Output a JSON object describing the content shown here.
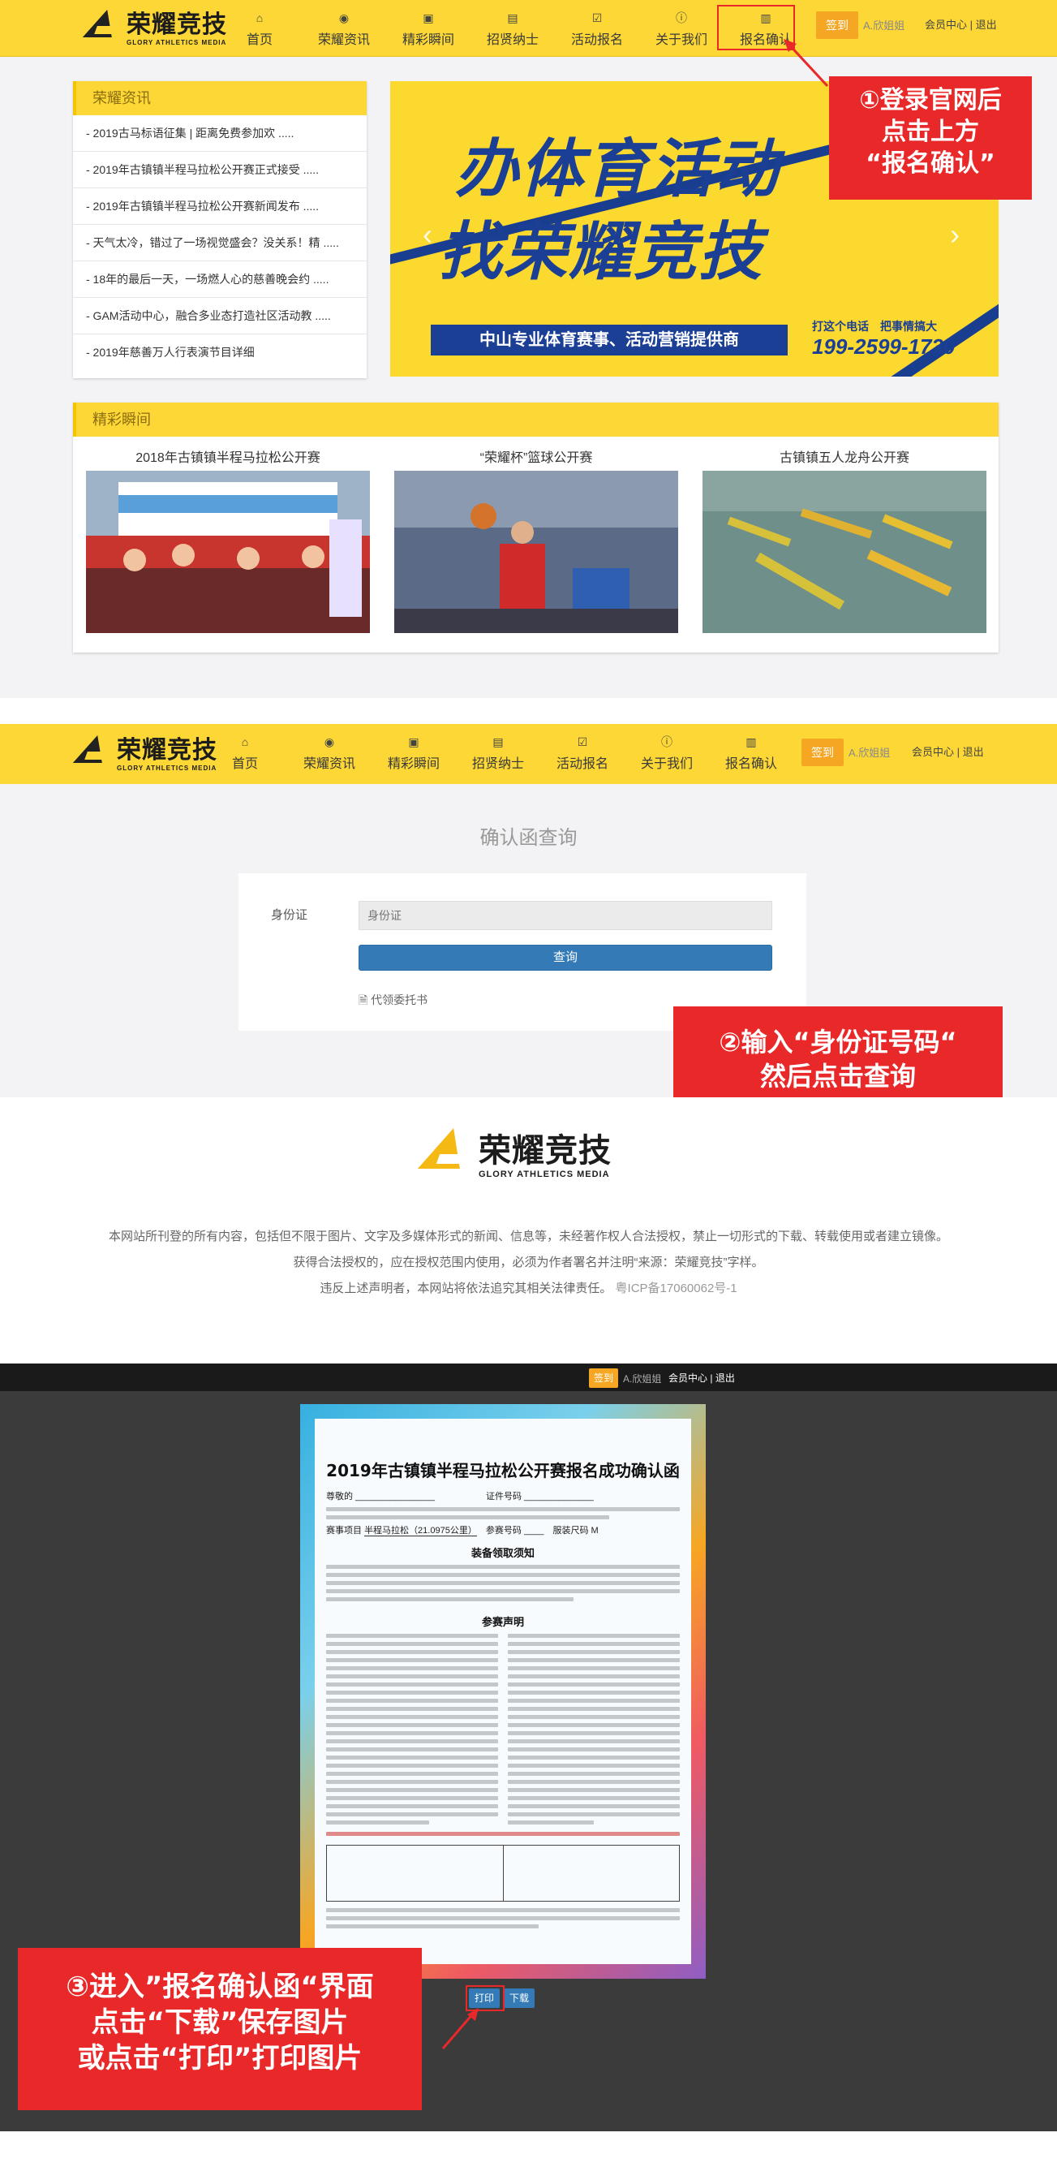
{
  "brand": {
    "name_cn": "荣耀竞技",
    "name_en": "GLORY ATHLETICS MEDIA"
  },
  "nav": [
    {
      "icon": "home-icon",
      "glyph": "⌂",
      "label": "首页"
    },
    {
      "icon": "eye-icon",
      "glyph": "◉",
      "label": "荣耀资讯"
    },
    {
      "icon": "picture-icon",
      "glyph": "▣",
      "label": "精彩瞬间"
    },
    {
      "icon": "file-icon",
      "glyph": "▤",
      "label": "招贤纳士"
    },
    {
      "icon": "checklist-icon",
      "glyph": "☑",
      "label": "活动报名"
    },
    {
      "icon": "info-icon",
      "glyph": "ⓘ",
      "label": "关于我们"
    },
    {
      "icon": "document-icon",
      "glyph": "▥",
      "label": "报名确认"
    }
  ],
  "user": {
    "signin": "签到",
    "name": "A.欣姐姐",
    "member_center": "会员中心",
    "separator": "|",
    "logout": "退出"
  },
  "news": {
    "heading": "荣耀资讯",
    "items": [
      "- 2019古马标语征集 | 距离免费参加欢 .....",
      "- 2019年古镇镇半程马拉松公开赛正式接受 .....",
      "- 2019年古镇镇半程马拉松公开赛新闻发布 .....",
      "- 天气太冷，错过了一场视觉盛会？没关系！精 .....",
      "- 18年的最后一天，一场燃人心的慈善晚会约 .....",
      "- GAM活动中心，融合多业态打造社区活动教 .....",
      "- 2019年慈善万人行表演节目详细"
    ]
  },
  "banner": {
    "line1": "办体育活动",
    "line2": "找荣耀竞技",
    "subtitle": "中山专业体育赛事、活动营销提供商",
    "call_text": "打这个电话　把事情搞大",
    "phone": "199-2599-1730"
  },
  "highlights": {
    "heading": "精彩瞬间",
    "items": [
      {
        "title": "2018年古镇镇半程马拉松公开赛"
      },
      {
        "title": "“荣耀杯”篮球公开赛"
      },
      {
        "title": "古镇镇五人龙舟公开赛"
      }
    ]
  },
  "query": {
    "title": "确认函查询",
    "id_label": "身份证",
    "id_placeholder": "身份证",
    "button": "查询",
    "proxy_link": "代领委托书"
  },
  "footer": {
    "line1": "本网站所刊登的所有内容，包括但不限于图片、文字及多媒体形式的新闻、信息等，未经著作权人合法授权，禁止一切形式的下载、转载使用或者建立镜像。",
    "line2": "获得合法授权的，应在授权范围内使用，必须为作者署名并注明“来源：荣耀竞技”字样。",
    "line3_prefix": "违反上述声明者，本网站将依法追究其相关法律责任。",
    "icp": "粤ICP备17060062号-1"
  },
  "confirmation": {
    "title": "2019年古镇镇半程马拉松公开赛报名成功确认函",
    "name_label": "尊敬的",
    "id_label": "证件号码",
    "event_label": "赛事项目",
    "event_value": "半程马拉松（21.0975公里）",
    "bib_label": "参赛号码",
    "size_label": "服装尺码",
    "size_value": "M",
    "section1": "装备领取须知",
    "section2": "参赛声明",
    "print_button": "打印",
    "download_button": "下载"
  },
  "callouts": {
    "c1": [
      "①登录官网后",
      "点击上方",
      "“报名确认”"
    ],
    "c2": [
      "②输入“身份证号码“",
      "然后点击查询"
    ],
    "c3": [
      "③进入”报名确认函“界面",
      "点击“下载”保存图片",
      "或点击“打印”打印图片"
    ]
  },
  "colors": {
    "brand_yellow": "#fcd735",
    "callout_red": "#e9282a",
    "button_blue": "#337ab7",
    "signin_orange": "#f5a623"
  }
}
